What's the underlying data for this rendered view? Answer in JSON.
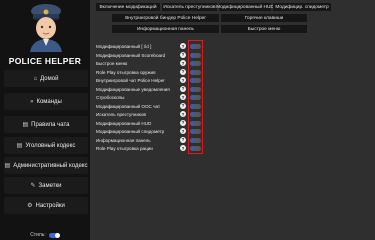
{
  "brand": {
    "name": "POLICE HELPER"
  },
  "sidebar": {
    "items": [
      {
        "icon": "home-icon",
        "glyph": "⌂",
        "label": "Домой"
      },
      {
        "icon": "chevrons-icon",
        "glyph": "»",
        "label": "Команды"
      },
      {
        "icon": "book-icon",
        "glyph": "▤",
        "label": "Правила чата"
      },
      {
        "icon": "book-icon",
        "glyph": "▤",
        "label": "Уголовный кодекс"
      },
      {
        "icon": "book-icon",
        "glyph": "▤",
        "label": "Административный кодекс"
      },
      {
        "icon": "notes-icon",
        "glyph": "✎",
        "label": "Заметки"
      },
      {
        "icon": "gear-icon",
        "glyph": "⚙",
        "label": "Настройки"
      }
    ],
    "theme_label": "Стиль:"
  },
  "tabs": [
    "Включение модификаций",
    "Искатель преступников",
    "Модифицированный HUD",
    "Модифицир. спидометр",
    "Внутриигровой биндер Police Helper",
    "Горячие клавиши",
    "Информационная панель",
    "Быстрое меню"
  ],
  "settings": [
    {
      "label": "Модифицированный [ /id ]",
      "enabled": false
    },
    {
      "label": "Модифицированный Scoreboard",
      "enabled": false
    },
    {
      "label": "Быстрое меню",
      "enabled": false
    },
    {
      "label": "Role Play отыгровка оружия",
      "enabled": false
    },
    {
      "label": "Внутриигровой чат Police Helper",
      "enabled": false
    },
    {
      "label": "Модифицированные уведомления",
      "enabled": false
    },
    {
      "label": "Стробоскопы",
      "enabled": false
    },
    {
      "label": "Модифицированный ООС чат",
      "enabled": false
    },
    {
      "label": "Искатель преступников",
      "enabled": false
    },
    {
      "label": "Модифицированный HUD",
      "enabled": false
    },
    {
      "label": "Модифицированный спидометр",
      "enabled": false
    },
    {
      "label": "Информационная панель",
      "enabled": false
    },
    {
      "label": "Role Play отыгровка рации",
      "enabled": false
    }
  ],
  "help_glyph": "?",
  "colors": {
    "highlight": "#e01818",
    "toggle_knob": "#3f5a9e",
    "toggle_track": "#56565e"
  }
}
